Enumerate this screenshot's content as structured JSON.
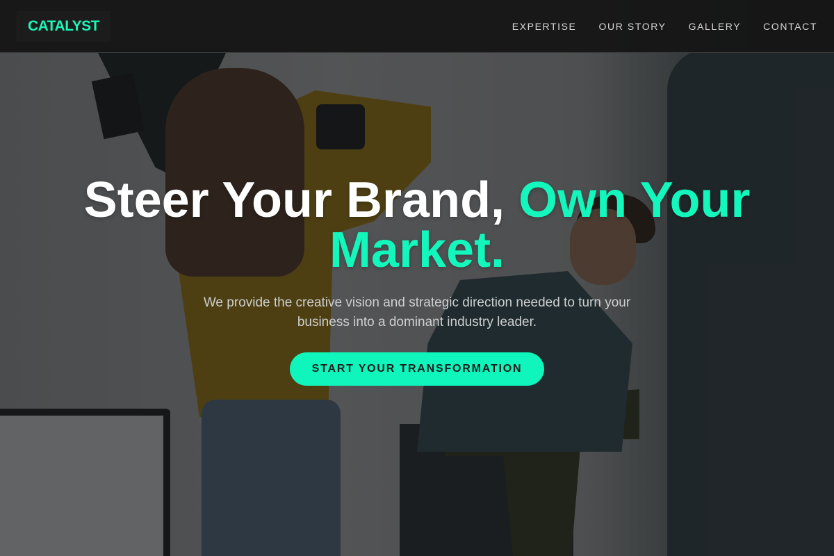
{
  "brand": {
    "name": "CATALYST",
    "accent_color": "#13f7bd"
  },
  "nav": {
    "items": [
      {
        "label": "EXPERTISE"
      },
      {
        "label": "OUR STORY"
      },
      {
        "label": "GALLERY"
      },
      {
        "label": "CONTACT"
      }
    ]
  },
  "hero": {
    "headline_part1": "Steer Your Brand,",
    "headline_part2": "Own Your Market.",
    "subtext": "We provide the creative vision and strategic direction needed to turn your business into a dominant industry leader.",
    "cta_label": "START YOUR TRANSFORMATION",
    "background_image": "photo-studio-shoot"
  }
}
